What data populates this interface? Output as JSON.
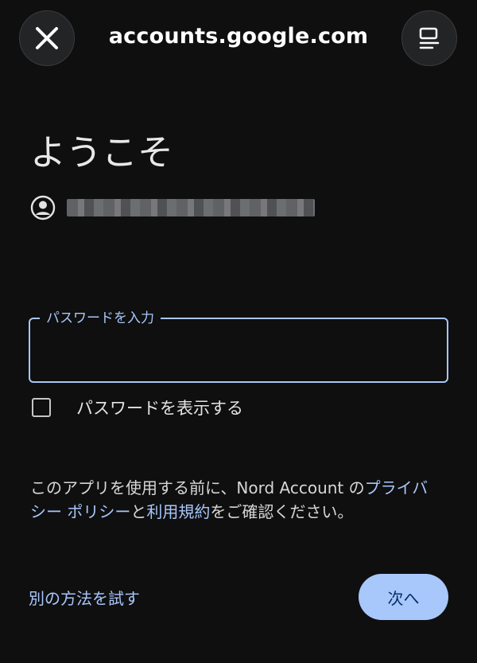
{
  "browser": {
    "url": "accounts.google.com",
    "close_icon": "close-icon",
    "menu_icon": "tab-menu-icon"
  },
  "page": {
    "title": "ようこそ",
    "account_icon": "account-circle-icon",
    "email_masked": ""
  },
  "password_field": {
    "label": "パスワードを入力",
    "value": ""
  },
  "show_password": {
    "label": "パスワードを表示する",
    "checked": false
  },
  "notice": {
    "prefix": "このアプリを使用する前に、Nord Account の",
    "privacy_link": "プライバシー ポリシー",
    "and": "と",
    "terms_link": "利用規約",
    "suffix": "をご確認ください。"
  },
  "actions": {
    "try_another": "別の方法を試す",
    "next": "次へ"
  },
  "colors": {
    "background": "#0f0f10",
    "accent": "#a8c7fa",
    "next_text": "#062e6f"
  }
}
